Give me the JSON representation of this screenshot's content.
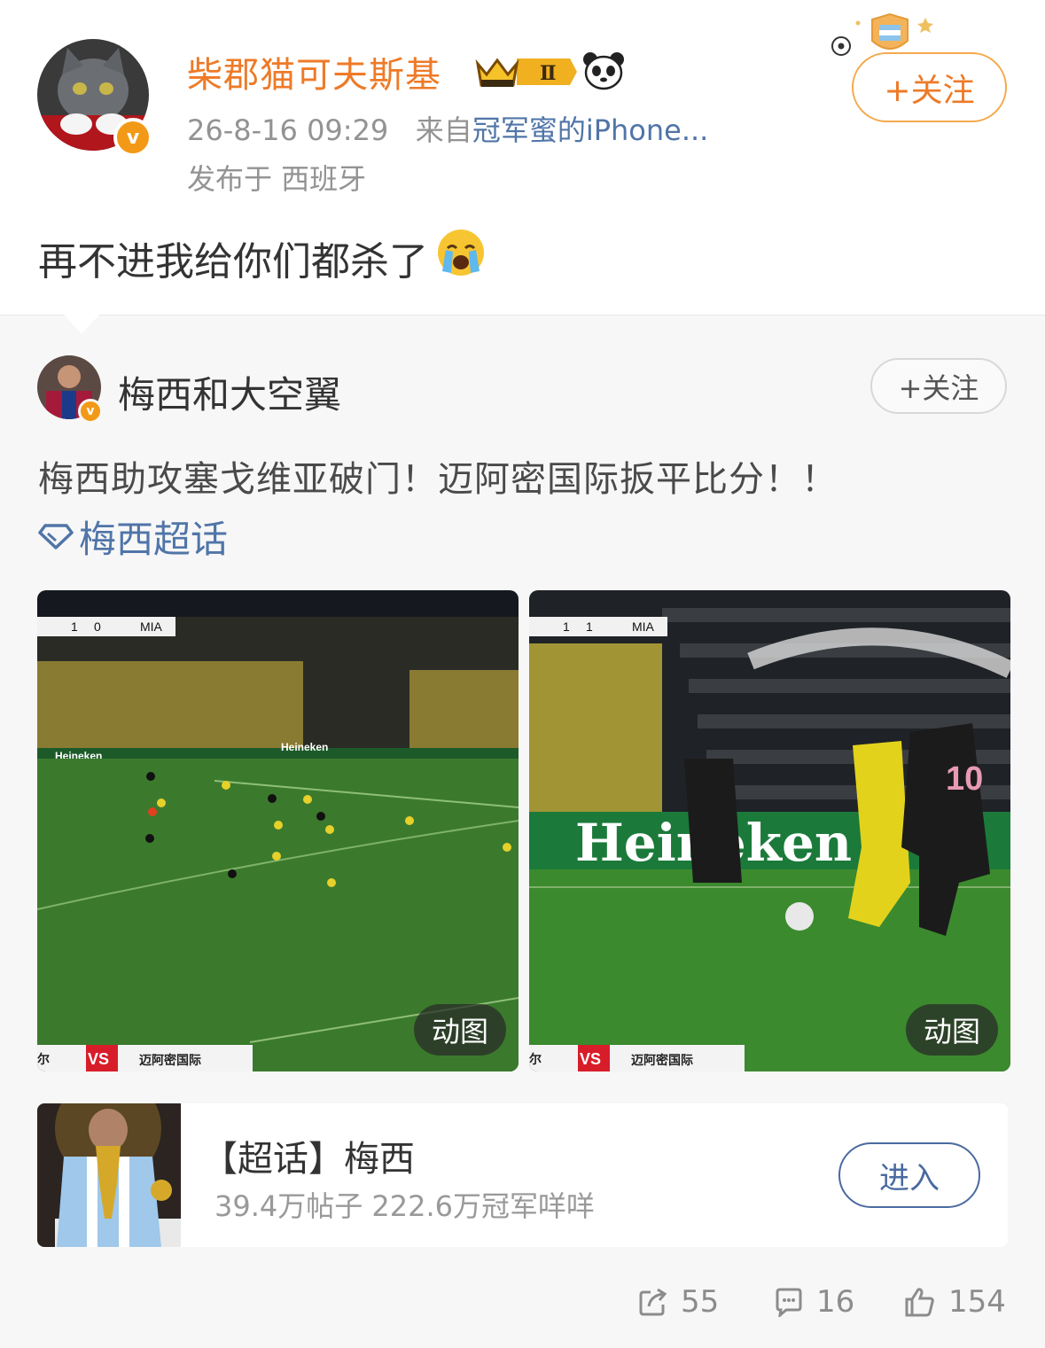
{
  "post": {
    "username": "柴郡猫可夫斯基",
    "level_badge": "Ⅱ",
    "verified_badge": "v",
    "timestamp": "26-8-16 09:29",
    "source_prefix": "来自",
    "source_device": "冠军蜜的iPhone...",
    "location": "发布于 西班牙",
    "follow_label": "+关注",
    "text": "再不进我给你们都杀了",
    "emoji_name": "cry-emoji"
  },
  "retweet": {
    "username": "梅西和大空翼",
    "verified_badge": "v",
    "follow_label": "+关注",
    "text": "梅西助攻塞戈维亚破门！迈阿密国际扳平比分！！",
    "topic_link": "梅西超话",
    "media": [
      {
        "score_home": "1",
        "score_away": "0",
        "team_code": "MIA",
        "left_label": "尔",
        "vs_label": "VS",
        "team_label": "迈阿密国际",
        "gif_label": "动图"
      },
      {
        "score_home": "1",
        "score_away": "1",
        "team_code": "MIA",
        "left_label": "尔",
        "vs_label": "VS",
        "team_label": "迈阿密国际",
        "gif_label": "动图"
      }
    ],
    "topic_card": {
      "title": "【超话】梅西",
      "stats": "39.4万帖子 222.6万冠军咩咩",
      "enter_label": "进入"
    }
  },
  "actions": {
    "share_count": "55",
    "comment_count": "16",
    "like_count": "154"
  },
  "colors": {
    "username_orange": "#ee7a27",
    "link_blue": "#5075a8",
    "muted_gray": "#939393",
    "pitch_green": "#3b7a2c"
  }
}
